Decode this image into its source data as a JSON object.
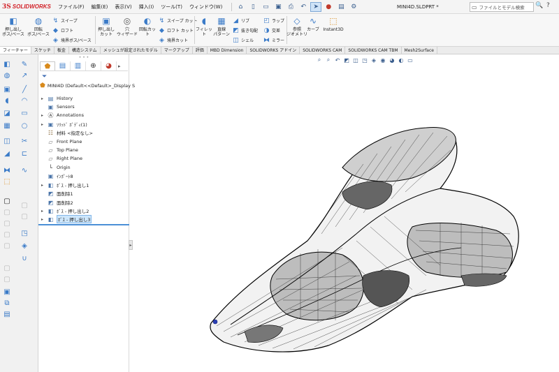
{
  "app": {
    "logo_ds": "3S",
    "logo_text": "SOLIDWORKS",
    "document_title": "MINI4D.SLDPRT *"
  },
  "menus": [
    "ファイル(F)",
    "編集(E)",
    "表示(V)",
    "挿入(I)",
    "ツール(T)",
    "ウィンドウ(W)"
  ],
  "quick_access": [
    {
      "icon": "home-icon",
      "glyph": "⌂"
    },
    {
      "icon": "new-document-icon",
      "glyph": "▯"
    },
    {
      "icon": "open-folder-icon",
      "glyph": "▭"
    },
    {
      "icon": "save-icon",
      "glyph": "▣"
    },
    {
      "icon": "print-icon",
      "glyph": "⎙"
    },
    {
      "icon": "undo-icon",
      "glyph": "↶"
    },
    {
      "icon": "select-pointer-icon",
      "glyph": "➤"
    },
    {
      "icon": "rebuild-icon",
      "glyph": "●"
    },
    {
      "icon": "file-properties-icon",
      "glyph": "▤"
    },
    {
      "icon": "options-gear-icon",
      "glyph": "⚙"
    }
  ],
  "search": {
    "placeholder": "ファイルとモデル検索",
    "go_glyph": "🔍",
    "help_glyph": "?"
  },
  "ribbon": {
    "extruded_boss": "押し出し\nボス/ベース",
    "revolved_boss": "回転\nボス/ベース",
    "swept_boss": "スイープ",
    "lofted_boss": "ロフト",
    "boundary_boss": "境界ボス/ベース",
    "extruded_cut": "押し出し\nカット",
    "hole_wizard": "穴\nウィザード",
    "revolved_cut": "回転カット",
    "swept_cut": "スイープ カット",
    "lofted_cut": "ロフト カット",
    "boundary_cut": "境界カット",
    "fillet": "フィレット",
    "linear_pattern": "直線\nパターン",
    "rib": "リブ",
    "draft": "抜き勾配",
    "shell": "シェル",
    "wrap": "ラップ",
    "intersect": "交差",
    "mirror": "ミラー",
    "reference_geometry": "参照\nジオメトリ",
    "curves": "カーブ",
    "instant3d": "Instant3D"
  },
  "tabs": [
    {
      "label": "フィーチャー",
      "active": true
    },
    {
      "label": "スケッチ",
      "active": false
    },
    {
      "label": "板金",
      "active": false
    },
    {
      "label": "構造システム",
      "active": false
    },
    {
      "label": "メッシュが設定されたモデル",
      "active": false
    },
    {
      "label": "マークアップ",
      "active": false
    },
    {
      "label": "評価",
      "active": false
    },
    {
      "label": "MBD Dimension",
      "active": false
    },
    {
      "label": "SOLIDWORKS アドイン",
      "active": false
    },
    {
      "label": "SOLIDWORKS CAM",
      "active": false
    },
    {
      "label": "SOLIDWORKS CAM TBM",
      "active": false
    },
    {
      "label": "Mesh2Surface",
      "active": false
    }
  ],
  "feature_tree": {
    "grip": "• • •",
    "root": "MINI4D  (Default<<Default>_Display S",
    "items": [
      {
        "label": "History",
        "expandable": true,
        "icon": "history-folder-icon"
      },
      {
        "label": "Sensors",
        "expandable": false,
        "icon": "sensors-folder-icon"
      },
      {
        "label": "Annotations",
        "expandable": true,
        "icon": "annotations-icon"
      },
      {
        "label": "ｿﾘｯﾄﾞ ﾎﾞﾃﾞｨ(1)",
        "expandable": true,
        "icon": "solid-bodies-folder-icon"
      },
      {
        "label": "材料 <指定なし>",
        "expandable": false,
        "icon": "material-icon"
      },
      {
        "label": "Front Plane",
        "expandable": false,
        "icon": "plane-icon"
      },
      {
        "label": "Top Plane",
        "expandable": false,
        "icon": "plane-icon"
      },
      {
        "label": "Right Plane",
        "expandable": false,
        "icon": "plane-icon"
      },
      {
        "label": "Origin",
        "expandable": false,
        "icon": "origin-icon"
      },
      {
        "label": "ｲﾝﾎﾟｰﾄ8",
        "expandable": false,
        "icon": "import-feature-icon"
      },
      {
        "label": "ﾎﾞｽ - 押し出し1",
        "expandable": true,
        "icon": "boss-extrude-icon"
      },
      {
        "label": "面削除1",
        "expandable": false,
        "icon": "delete-face-icon"
      },
      {
        "label": "面削除2",
        "expandable": false,
        "icon": "delete-face-icon"
      },
      {
        "label": "ﾎﾞｽ - 押し出し2",
        "expandable": true,
        "icon": "boss-extrude-icon"
      },
      {
        "label": "ﾎﾞｽ - 押し出し3",
        "expandable": true,
        "icon": "boss-extrude-icon",
        "selected": true
      }
    ]
  },
  "colors": {
    "accent_blue": "#4a8fd6",
    "selection_bg": "#cde6fb",
    "brand_red": "#d2232a"
  }
}
